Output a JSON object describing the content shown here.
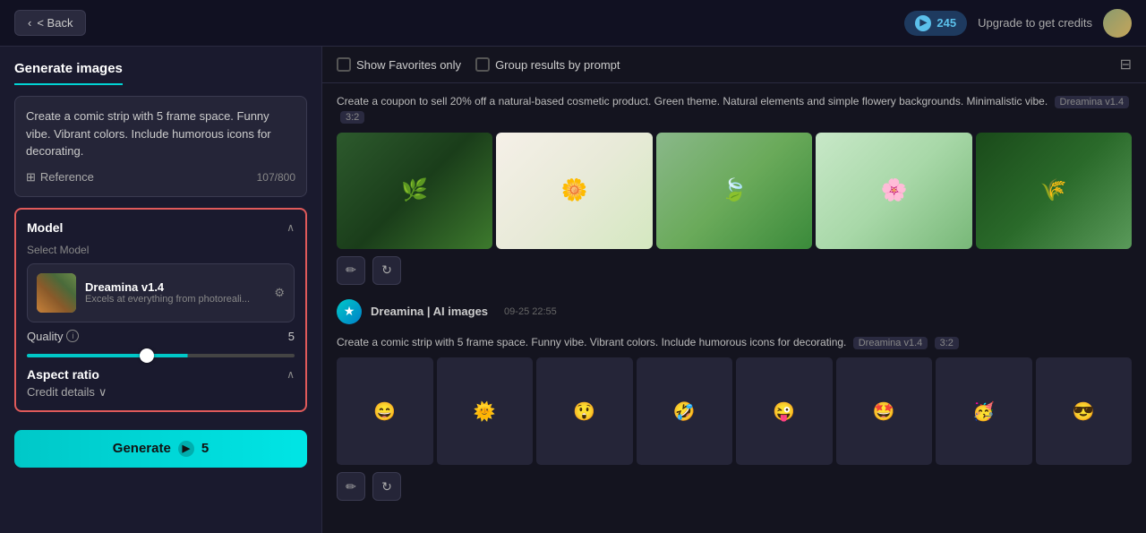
{
  "topbar": {
    "back_label": "< Back",
    "credits_count": "245",
    "upgrade_label": "Upgrade to get credits"
  },
  "sidebar": {
    "title": "Generate images",
    "prompt_text": "Create a comic strip with 5 frame space. Funny vibe. Vibrant colors. Include humorous icons for decorating.",
    "reference_label": "Reference",
    "char_count": "107/800",
    "model_section": {
      "title": "Model",
      "select_label": "Select Model",
      "model_name": "Dreamina v1.4",
      "model_desc": "Excels at everything from photoreali...",
      "quality_label": "Quality",
      "quality_value": "5",
      "aspect_ratio_label": "Aspect ratio",
      "credit_details_label": "Credit details"
    },
    "generate_btn_label": "Generate",
    "generate_cost": "5"
  },
  "toolbar": {
    "show_favorites_label": "Show Favorites only",
    "group_by_prompt_label": "Group results by prompt"
  },
  "results": [
    {
      "prompt": "Create a coupon to sell 20% off a natural-based cosmetic product. Green theme. Natural elements and simple flowery backgrounds. Minimalistic vibe.",
      "model": "Dreamina v1.4",
      "ratio": "3:2",
      "images": [
        "cosm-1",
        "cosm-2",
        "cosm-3",
        "cosm-4",
        "cosm-5"
      ]
    },
    {
      "source": "Dreamina | AI images",
      "date": "09-25",
      "time": "22:55",
      "prompt": "Create a comic strip with 5 frame space. Funny vibe. Vibrant colors. Include humorous icons for decorating.",
      "model": "Dreamina v1.4",
      "ratio": "3:2",
      "images": [
        "comic-1",
        "comic-2",
        "comic-3",
        "comic-4",
        "comic-5",
        "comic-6",
        "comic-7",
        "comic-8"
      ]
    }
  ]
}
